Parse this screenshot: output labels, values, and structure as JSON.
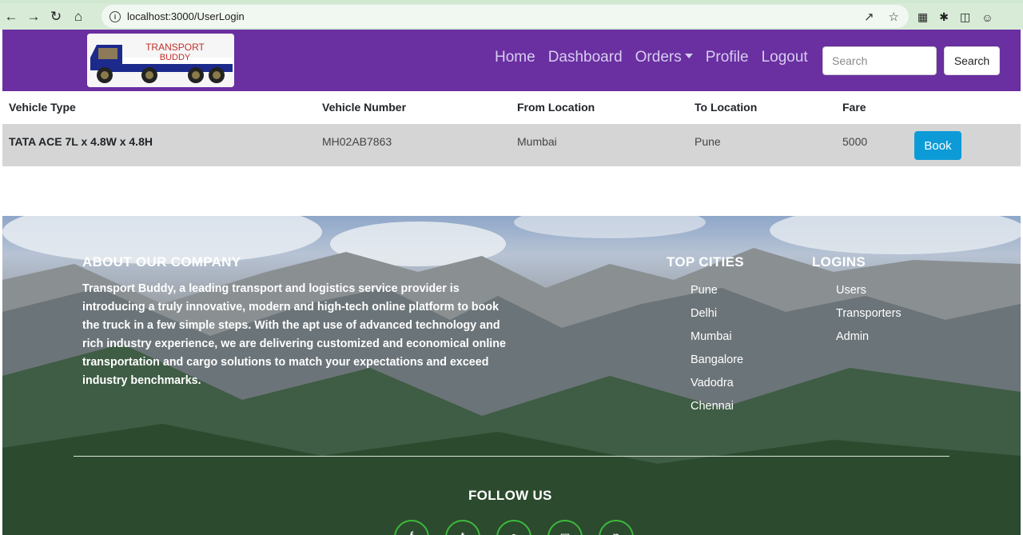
{
  "browser": {
    "url": "localhost:3000/UserLogin",
    "back_icon": "arrow-left-icon",
    "forward_icon": "arrow-right-icon",
    "reload_icon": "reload-icon",
    "home_icon": "home-icon"
  },
  "navbar": {
    "logo_text_line1": "TRANSPORT",
    "logo_text_line2": "BUDDY",
    "links": [
      "Home",
      "Dashboard",
      "Orders",
      "Profile",
      "Logout"
    ],
    "search_placeholder": "Search",
    "search_button": "Search",
    "bg_color": "#6a2fa0"
  },
  "table": {
    "headers": [
      "Vehicle Type",
      "Vehicle Number",
      "From Location",
      "To Location",
      "Fare"
    ],
    "rows": [
      {
        "vehicle_type": "TATA ACE 7L x 4.8W x 4.8H",
        "vehicle_number": "MH02AB7863",
        "from": "Mumbai",
        "to": "Pune",
        "fare": "5000",
        "action": "Book"
      }
    ]
  },
  "footer": {
    "about_heading": "ABOUT OUR COMPANY",
    "about_text": "Transport Buddy, a leading transport and logistics service provider is introducing a truly innovative, modern and high-tech online platform to book the truck in a few simple steps. With the apt use of advanced technology and rich industry experience, we are delivering customized and economical online transportation and cargo solutions to match your expectations and exceed industry benchmarks.",
    "cities_heading": "TOP CITIES",
    "cities": [
      "Pune",
      "Delhi",
      "Mumbai",
      "Bangalore",
      "Vadodra",
      "Chennai"
    ],
    "logins_heading": "LOGINS",
    "logins": [
      "Users",
      "Transporters",
      "Admin"
    ],
    "follow_heading": "FOLLOW US",
    "social_icons": [
      "facebook-icon",
      "twitter-icon",
      "location-icon",
      "instagram-icon",
      "pinterest-icon"
    ]
  }
}
